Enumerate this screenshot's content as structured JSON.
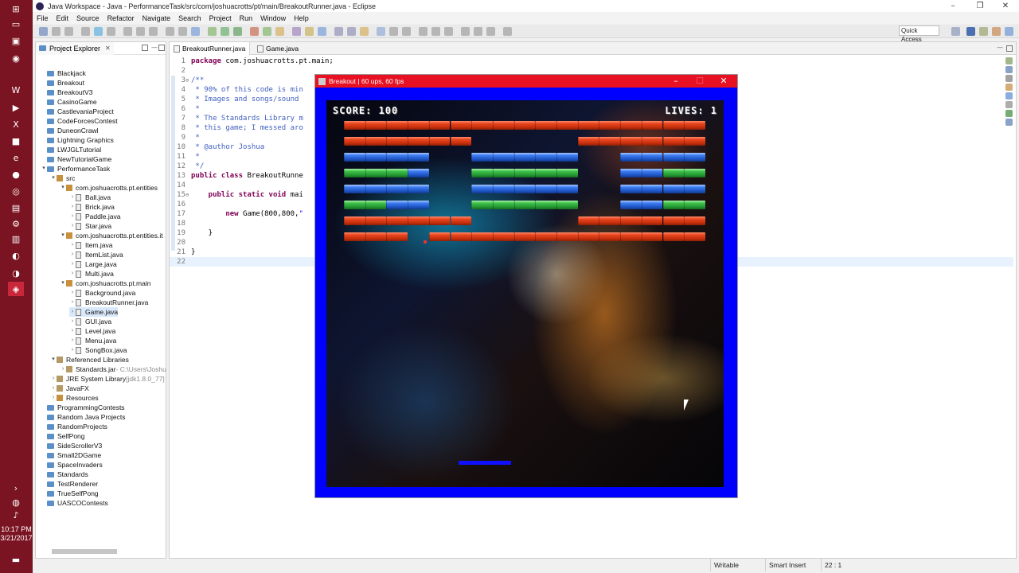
{
  "taskbar": {
    "icons": [
      "windows-start-icon",
      "task-view-icon",
      "file-explorer-icon",
      "steam-icon",
      "word-icon",
      "powerpoint-icon",
      "excel-icon",
      "minecraft-icon",
      "edge-icon",
      "firefox-icon",
      "chrome-icon",
      "remote-desktop-icon",
      "settings-icon",
      "presentation-icon",
      "media-icon",
      "media-icon-2",
      "eclipse-icon"
    ],
    "clock_time": "10:17 PM",
    "clock_date": "3/21/2017"
  },
  "eclipse": {
    "title": "Java Workspace - Java - PerformanceTask/src/com/joshuacrotts/pt/main/BreakoutRunner.java - Eclipse",
    "menu": [
      "File",
      "Edit",
      "Source",
      "Refactor",
      "Navigate",
      "Search",
      "Project",
      "Run",
      "Window",
      "Help"
    ],
    "quick_access": "Quick Access",
    "explorer": {
      "title": "Project Explorer",
      "tree": [
        {
          "label": "Blackjack",
          "type": "folder",
          "depth": 0,
          "arrow": ""
        },
        {
          "label": "Breakout",
          "type": "folder",
          "depth": 0,
          "arrow": ""
        },
        {
          "label": "BreakoutV3",
          "type": "folder",
          "depth": 0,
          "arrow": ""
        },
        {
          "label": "CasinoGame",
          "type": "folder",
          "depth": 0,
          "arrow": ""
        },
        {
          "label": "CastlevaniaProject",
          "type": "folder",
          "depth": 0,
          "arrow": ""
        },
        {
          "label": "CodeForcesContest",
          "type": "folder",
          "depth": 0,
          "arrow": ""
        },
        {
          "label": "DuneonCrawl",
          "type": "folder",
          "depth": 0,
          "arrow": ""
        },
        {
          "label": "Lightning Graphics",
          "type": "folder",
          "depth": 0,
          "arrow": ""
        },
        {
          "label": "LWJGLTutorial",
          "type": "folder",
          "depth": 0,
          "arrow": ""
        },
        {
          "label": "NewTutorialGame",
          "type": "folder",
          "depth": 0,
          "arrow": ""
        },
        {
          "label": "PerformanceTask",
          "type": "folder",
          "depth": 0,
          "arrow": "v"
        },
        {
          "label": "src",
          "type": "pkg",
          "depth": 1,
          "arrow": "v"
        },
        {
          "label": "com.joshuacrotts.pt.entities",
          "type": "pkg",
          "depth": 2,
          "arrow": "v"
        },
        {
          "label": "Ball.java",
          "type": "file",
          "depth": 3,
          "arrow": ">"
        },
        {
          "label": "Brick.java",
          "type": "file",
          "depth": 3,
          "arrow": ">"
        },
        {
          "label": "Paddle.java",
          "type": "file",
          "depth": 3,
          "arrow": ">"
        },
        {
          "label": "Star.java",
          "type": "file",
          "depth": 3,
          "arrow": ">"
        },
        {
          "label": "com.joshuacrotts.pt.entities.it",
          "type": "pkg",
          "depth": 2,
          "arrow": "v"
        },
        {
          "label": "Item.java",
          "type": "file",
          "depth": 3,
          "arrow": ">"
        },
        {
          "label": "ItemList.java",
          "type": "file",
          "depth": 3,
          "arrow": ">"
        },
        {
          "label": "Large.java",
          "type": "file",
          "depth": 3,
          "arrow": ">"
        },
        {
          "label": "Multi.java",
          "type": "file",
          "depth": 3,
          "arrow": ">"
        },
        {
          "label": "com.joshuacrotts.pt.main",
          "type": "pkg",
          "depth": 2,
          "arrow": "v"
        },
        {
          "label": "Background.java",
          "type": "file",
          "depth": 3,
          "arrow": ">"
        },
        {
          "label": "BreakoutRunner.java",
          "type": "file",
          "depth": 3,
          "arrow": ">"
        },
        {
          "label": "Game.java",
          "type": "file",
          "depth": 3,
          "arrow": ">",
          "selected": true
        },
        {
          "label": "GUI.java",
          "type": "file",
          "depth": 3,
          "arrow": ">"
        },
        {
          "label": "Level.java",
          "type": "file",
          "depth": 3,
          "arrow": ">"
        },
        {
          "label": "Menu.java",
          "type": "file",
          "depth": 3,
          "arrow": ">"
        },
        {
          "label": "SongBox.java",
          "type": "file",
          "depth": 3,
          "arrow": ">"
        },
        {
          "label": "Referenced Libraries",
          "type": "jar",
          "depth": 1,
          "arrow": "v"
        },
        {
          "label": "Standards.jar",
          "suffix": " - C:\\Users\\Joshu",
          "type": "jar",
          "depth": 2,
          "arrow": ">"
        },
        {
          "label": "JRE System Library",
          "suffix": " [jdk1.8.0_77]",
          "type": "jar",
          "depth": 1,
          "arrow": ">"
        },
        {
          "label": "JavaFX",
          "type": "jar",
          "depth": 1,
          "arrow": ">"
        },
        {
          "label": "Resources",
          "type": "pkg",
          "depth": 1,
          "arrow": ">"
        },
        {
          "label": "ProgrammingContests",
          "type": "folder",
          "depth": 0,
          "arrow": ""
        },
        {
          "label": "Random Java Projects",
          "type": "folder",
          "depth": 0,
          "arrow": ""
        },
        {
          "label": "RandomProjects",
          "type": "folder",
          "depth": 0,
          "arrow": ""
        },
        {
          "label": "SelfPong",
          "type": "folder",
          "depth": 0,
          "arrow": ""
        },
        {
          "label": "SideScrollerV3",
          "type": "folder",
          "depth": 0,
          "arrow": ""
        },
        {
          "label": "Small2DGame",
          "type": "folder",
          "depth": 0,
          "arrow": ""
        },
        {
          "label": "SpaceInvaders",
          "type": "folder",
          "depth": 0,
          "arrow": ""
        },
        {
          "label": "Standards",
          "type": "folder",
          "depth": 0,
          "arrow": ""
        },
        {
          "label": "TestRenderer",
          "type": "folder",
          "depth": 0,
          "arrow": ""
        },
        {
          "label": "TrueSelfPong",
          "type": "folder",
          "depth": 0,
          "arrow": ""
        },
        {
          "label": "UASCOContests",
          "type": "folder",
          "depth": 0,
          "arrow": ""
        }
      ]
    },
    "editor": {
      "tabs": [
        {
          "label": "BreakoutRunner.java",
          "active": true
        },
        {
          "label": "Game.java",
          "active": false
        }
      ],
      "lines": [
        {
          "n": "1",
          "segs": [
            {
              "t": "package ",
              "c": "kw"
            },
            {
              "t": "com.joshuacrotts.pt.main;",
              "c": ""
            }
          ]
        },
        {
          "n": "2",
          "segs": []
        },
        {
          "n": "3",
          "fold": "⊖",
          "segs": [
            {
              "t": "/**",
              "c": "doc"
            }
          ]
        },
        {
          "n": "4",
          "segs": [
            {
              "t": " * 90% of this code is min",
              "c": "doc"
            }
          ]
        },
        {
          "n": "5",
          "segs": [
            {
              "t": " * Images and songs/sound",
              "c": "doc"
            }
          ]
        },
        {
          "n": "6",
          "segs": [
            {
              "t": " *",
              "c": "doc"
            }
          ]
        },
        {
          "n": "7",
          "segs": [
            {
              "t": " * The Standards Library m",
              "c": "doc"
            }
          ]
        },
        {
          "n": "8",
          "segs": [
            {
              "t": " * this game; I messed aro",
              "c": "doc"
            }
          ]
        },
        {
          "n": "9",
          "segs": [
            {
              "t": " *",
              "c": "doc"
            }
          ]
        },
        {
          "n": "10",
          "segs": [
            {
              "t": " * @author Joshua",
              "c": "doc"
            }
          ]
        },
        {
          "n": "11",
          "segs": [
            {
              "t": " *",
              "c": "doc"
            }
          ]
        },
        {
          "n": "12",
          "segs": [
            {
              "t": " */",
              "c": "doc"
            }
          ]
        },
        {
          "n": "13",
          "segs": [
            {
              "t": "public class ",
              "c": "kw"
            },
            {
              "t": "BreakoutRunne",
              "c": ""
            }
          ]
        },
        {
          "n": "14",
          "segs": []
        },
        {
          "n": "15",
          "fold": "⊖",
          "segs": [
            {
              "t": "    public static void ",
              "c": "kw"
            },
            {
              "t": "mai",
              "c": ""
            }
          ]
        },
        {
          "n": "16",
          "segs": []
        },
        {
          "n": "17",
          "segs": [
            {
              "t": "        new ",
              "c": "kw"
            },
            {
              "t": "Game(800,800,",
              "c": ""
            },
            {
              "t": "\"",
              "c": "str"
            }
          ]
        },
        {
          "n": "18",
          "segs": []
        },
        {
          "n": "19",
          "segs": [
            {
              "t": "    }",
              "c": ""
            }
          ]
        },
        {
          "n": "20",
          "segs": []
        },
        {
          "n": "21",
          "segs": [
            {
              "t": "}",
              "c": ""
            }
          ]
        },
        {
          "n": "22",
          "segs": [],
          "current": true
        }
      ]
    },
    "status": {
      "writable": "Writable",
      "insert_mode": "Smart Insert",
      "position": "22 : 1"
    }
  },
  "game": {
    "title": "Breakout | 60 ups, 60 fps",
    "score_label": "SCORE: 100",
    "lives_label": "LIVES: 1",
    "brick_rows": [
      {
        "color": "red",
        "segments": [
          [
            0,
            17
          ]
        ]
      },
      {
        "color": "red",
        "segments": [
          [
            0,
            6
          ],
          [
            11,
            17
          ]
        ]
      },
      {
        "color": "blue",
        "segments": [
          [
            0,
            4
          ],
          [
            6,
            11
          ],
          [
            13,
            17
          ]
        ]
      },
      {
        "color": "green",
        "segments": [
          [
            0,
            4
          ],
          [
            6,
            11
          ],
          [
            13,
            17
          ]
        ]
      },
      {
        "color": "blue",
        "segments": [
          [
            0,
            4
          ],
          [
            6,
            11
          ],
          [
            13,
            17
          ]
        ]
      },
      {
        "color": "green",
        "segments": [
          [
            0,
            4
          ],
          [
            6,
            11
          ],
          [
            13,
            17
          ]
        ]
      },
      {
        "color": "red",
        "segments": [
          [
            0,
            6
          ],
          [
            11,
            17
          ]
        ]
      },
      {
        "color": "red",
        "segments": [
          [
            0,
            3
          ],
          [
            4,
            17
          ]
        ]
      }
    ],
    "mixed_bricks": [
      {
        "row": 3,
        "col": 3,
        "color": "blue"
      },
      {
        "row": 3,
        "col": 13,
        "color": "blue"
      },
      {
        "row": 3,
        "col": 14,
        "color": "blue"
      },
      {
        "row": 5,
        "col": 2,
        "color": "blue"
      },
      {
        "row": 5,
        "col": 3,
        "color": "blue"
      },
      {
        "row": 5,
        "col": 13,
        "color": "blue"
      },
      {
        "row": 5,
        "col": 14,
        "color": "blue"
      }
    ],
    "colors": {
      "border": "#0000fe",
      "title_bar": "#e81123",
      "paddle": "#1010ff"
    }
  }
}
